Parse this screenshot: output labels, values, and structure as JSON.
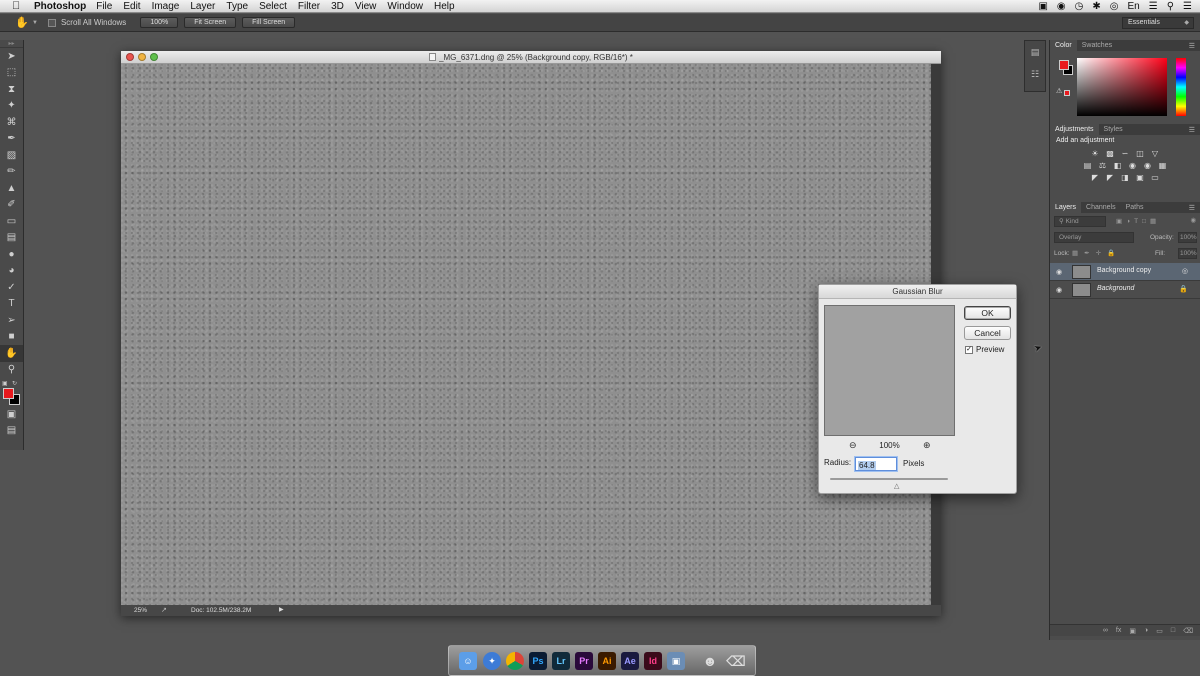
{
  "menubar": {
    "app_name": "Photoshop",
    "items": [
      "File",
      "Edit",
      "Image",
      "Layer",
      "Type",
      "Select",
      "Filter",
      "3D",
      "View",
      "Window",
      "Help"
    ],
    "input_source": "En"
  },
  "options_bar": {
    "scroll_all_windows": "Scroll All Windows",
    "btn_100": "100%",
    "btn_fit": "Fit Screen",
    "btn_fill": "Fill Screen",
    "workspace": "Essentials"
  },
  "document": {
    "title": "_MG_6371.dng @ 25% (Background copy, RGB/16*) *",
    "status_zoom": "25%",
    "status_doc": "Doc: 102.5M/238.2M"
  },
  "gaussian_blur": {
    "title": "Gaussian Blur",
    "ok": "OK",
    "cancel": "Cancel",
    "preview_label": "Preview",
    "preview_checked": true,
    "zoom": "100%",
    "radius_label": "Radius:",
    "radius_value": "64.8",
    "units": "Pixels"
  },
  "panels": {
    "color_tabs": [
      "Color",
      "Swatches"
    ],
    "adjust_tabs": [
      "Adjustments",
      "Styles"
    ],
    "add_adjustment": "Add an adjustment",
    "layers_tabs": [
      "Layers",
      "Channels",
      "Paths"
    ],
    "kind_filter": "Kind",
    "blend_mode": "Overlay",
    "opacity_label": "Opacity:",
    "opacity_value": "100%",
    "lock_label": "Lock:",
    "fill_label": "Fill:",
    "fill_value": "100%",
    "layers": [
      {
        "name": "Background copy",
        "selected": true
      },
      {
        "name": "Background",
        "selected": false,
        "locked": true
      }
    ]
  },
  "dock": {
    "apps": [
      "Finder",
      "Safari",
      "Chrome",
      "Ps",
      "Lr",
      "Pr",
      "Ai",
      "Ae",
      "Id",
      "Photos",
      "Launchpad",
      "Trash"
    ]
  },
  "colors": {
    "foreground": "#e8191d",
    "background": "#000000"
  }
}
